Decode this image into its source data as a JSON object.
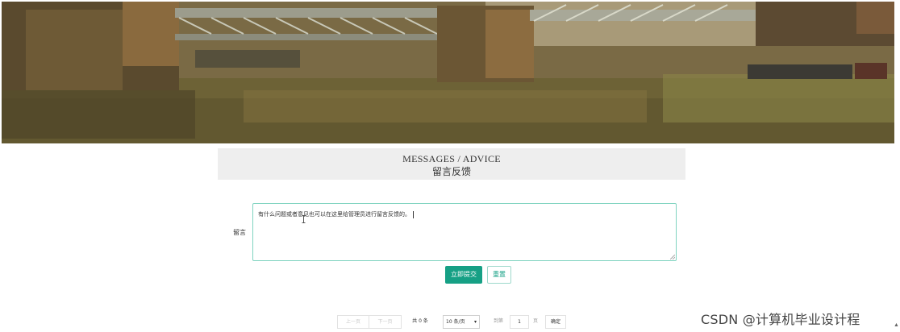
{
  "hero": {
    "image_name": "bridge-river-banner"
  },
  "heading": {
    "en": "MESSAGES / ADVICE",
    "zh": "留言反馈"
  },
  "form": {
    "message_label": "留言",
    "message_value": "有什么问题或者意见也可以在这里给管理员进行留言反馈的。",
    "submit_label": "立即提交",
    "reset_label": "重置"
  },
  "pager": {
    "prev_label": "上一页",
    "next_label": "下一页",
    "total_text": "共 0 条",
    "page_size_value": "10 条/页",
    "goto_label": "到第",
    "goto_value": "1",
    "page_unit": "页",
    "confirm_label": "确定"
  },
  "watermark": "CSDN @计算机毕业设计程",
  "colors": {
    "accent": "#16a085",
    "panel": "#eeeeee",
    "border_focus": "#7fd3c0"
  },
  "icons": {
    "cursor": "text-cursor-icon",
    "select": "chevron-down-icon",
    "scroll": "scroll-up-icon"
  }
}
